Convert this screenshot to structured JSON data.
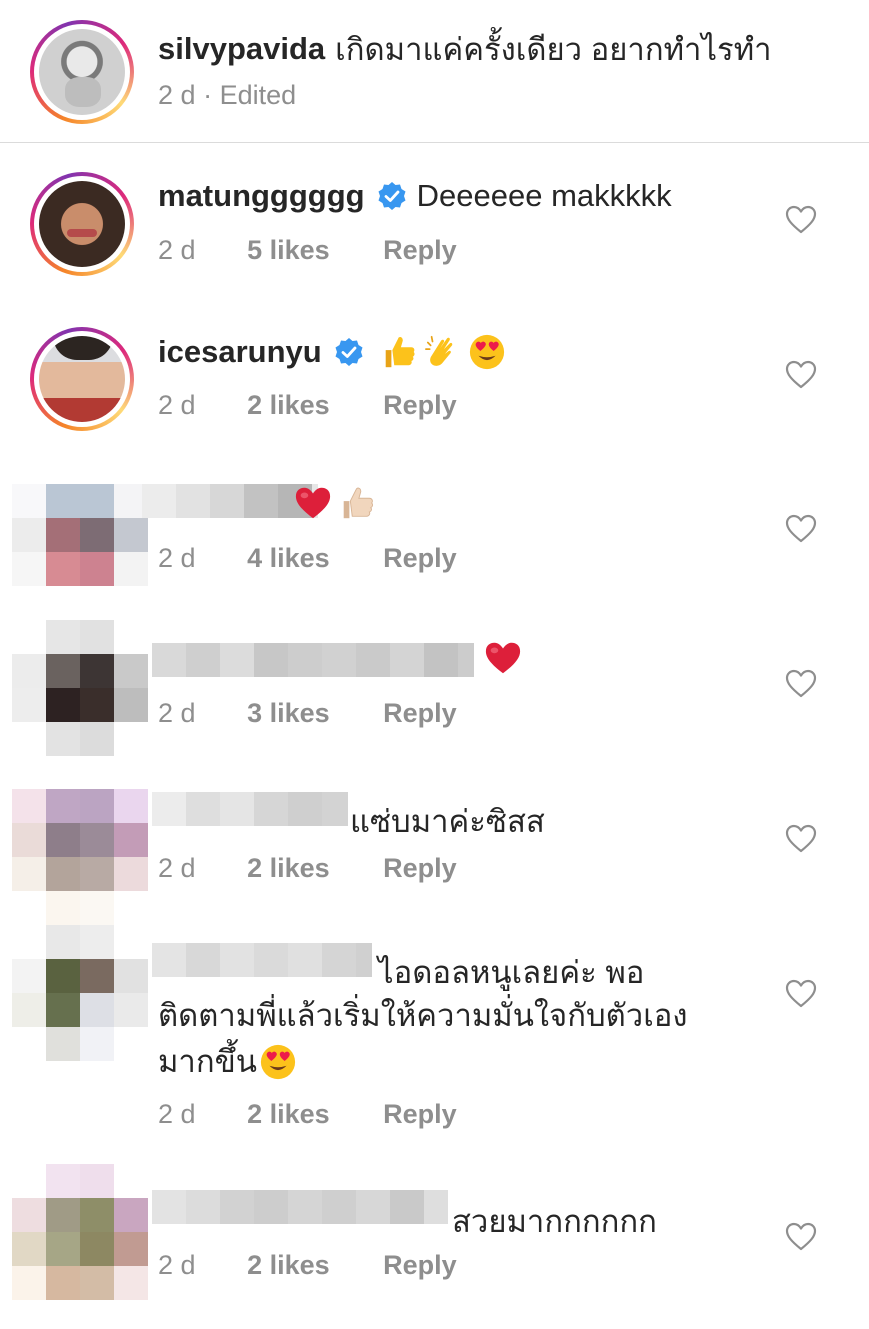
{
  "caption": {
    "username": "silvypavida",
    "text": "เกิดมาแค่ครั้งเดียว อยากทำไรทำ",
    "time": "2 d",
    "separator": "·",
    "edited": "Edited"
  },
  "comments": [
    {
      "username": "matungggggg",
      "verified": true,
      "text": "Deeeeee makkkkk",
      "time": "2 d",
      "likes": "5 likes",
      "reply": "Reply"
    },
    {
      "username": "icesarunyu",
      "verified": true,
      "emojis": [
        "thumbs-up",
        "clapping-hands",
        "heart-eyes"
      ],
      "time": "2 d",
      "likes": "2 likes",
      "reply": "Reply"
    },
    {
      "username_hidden": true,
      "emojis": [
        "red-heart",
        "thumbs-up-light"
      ],
      "time": "2 d",
      "likes": "4 likes",
      "reply": "Reply"
    },
    {
      "username_hidden": true,
      "emojis": [
        "red-heart"
      ],
      "time": "2 d",
      "likes": "3 likes",
      "reply": "Reply"
    },
    {
      "username_hidden": true,
      "text": "แซ่บมาค่ะซิสส",
      "time": "2 d",
      "likes": "2 likes",
      "reply": "Reply"
    },
    {
      "username_hidden": true,
      "text_line1": "ไอดอลหนูเลยค่ะ พอ",
      "text_line2": "ติดตามพี่แล้วเริ่มให้ความมั่นใจกับตัวเอง",
      "text_line3": "มากขึ้น",
      "emojis": [
        "heart-eyes"
      ],
      "time": "2 d",
      "likes": "2 likes",
      "reply": "Reply"
    },
    {
      "username_hidden": true,
      "text": "สวยมากกกกกก",
      "time": "2 d",
      "likes": "2 likes",
      "reply": "Reply"
    }
  ],
  "icons": {
    "like": "heart-outline-icon",
    "verified": "verified-badge-icon"
  },
  "colors": {
    "verified": "#3897f0",
    "meta": "#8e8e8e",
    "text": "#262626",
    "heart_icon": "#8e8e8e",
    "red_heart": "#e0245e"
  }
}
